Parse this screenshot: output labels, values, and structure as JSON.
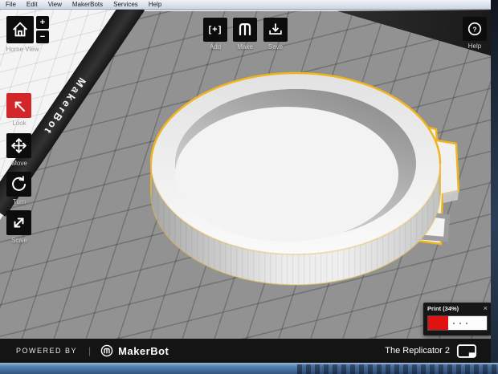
{
  "menu": [
    "File",
    "Edit",
    "View",
    "MakerBots",
    "Services",
    "Help"
  ],
  "toolbar": {
    "home_label": "Home View",
    "zoom_in": "+",
    "zoom_out": "−",
    "add_label": "Add",
    "make_label": "Make",
    "save_label": "Save",
    "help_label": "Help"
  },
  "tools": {
    "look_label": "Look",
    "move_label": "Move",
    "turn_label": "Turn",
    "scale_label": "Scale"
  },
  "viewport": {
    "plate_brand": "MakerBot"
  },
  "print_popup": {
    "title": "Print (34%)",
    "close": "×",
    "progress_percent": 34
  },
  "footer": {
    "powered_by": "POWERED BY",
    "separator": "|",
    "brand": "MakerBot",
    "printer_name": "The Replicator 2"
  },
  "colors": {
    "accent_red": "#d3262a",
    "selection_yellow": "#f0b41e",
    "progress_red": "#e01212"
  }
}
